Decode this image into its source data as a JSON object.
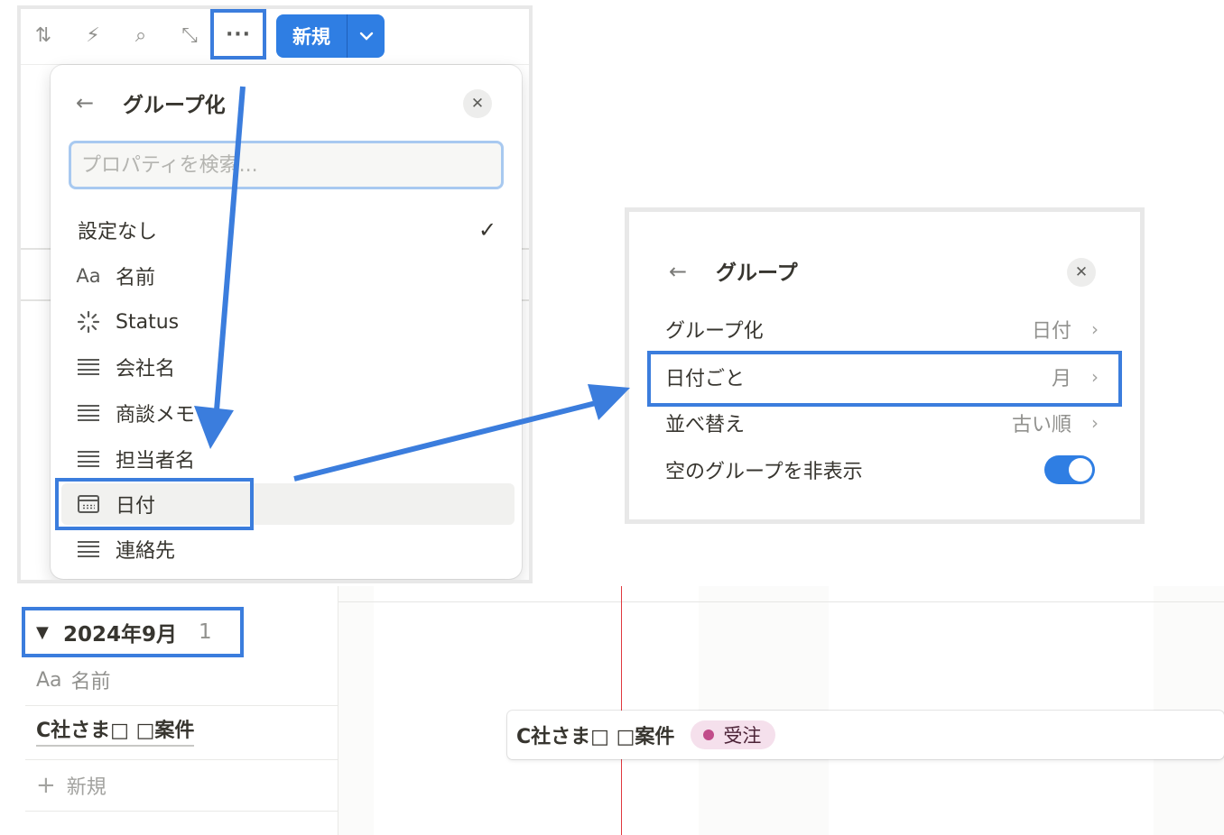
{
  "toolbar": {
    "sort_icon": "⇅",
    "automation_icon": "⚡",
    "search_icon": "⌕",
    "expand_icon": "⤡",
    "more_icon": "···",
    "new_label": "新規",
    "new_chevron": "⌄"
  },
  "group_menu": {
    "back_icon": "←",
    "title": "グループ化",
    "close_icon": "✕",
    "search_placeholder": "プロパティを検索...",
    "none_label": "設定なし",
    "check_icon": "✓",
    "items": [
      {
        "icon": "Aa",
        "label": "名前"
      },
      {
        "icon": "✳",
        "label": "Status"
      },
      {
        "icon": "lines",
        "label": "会社名"
      },
      {
        "icon": "lines",
        "label": "商談メモ"
      },
      {
        "icon": "lines",
        "label": "担当者名"
      },
      {
        "icon": "calendar",
        "label": "日付"
      },
      {
        "icon": "lines",
        "label": "連絡先"
      }
    ]
  },
  "group_panel": {
    "back_icon": "←",
    "title": "グループ",
    "close_icon": "✕",
    "rows": [
      {
        "label": "グループ化",
        "value": "日付",
        "chevron": "›"
      },
      {
        "label": "日付ごと",
        "value": "月",
        "chevron": "›"
      },
      {
        "label": "並べ替え",
        "value": "古い順",
        "chevron": "›"
      },
      {
        "label": "空のグループを非表示",
        "toggle_on": true
      }
    ]
  },
  "timeline": {
    "group_toggle": "▼",
    "group_title": "2024年9月",
    "group_count": "1",
    "name_column_icon": "Aa",
    "name_column_label": "名前",
    "row_title": "C社さま□ □案件",
    "add_icon": "+",
    "add_label": "新規",
    "card_title": "C社さま□ □案件",
    "status_label": "受注",
    "status_color": "#c14c8a"
  },
  "colors": {
    "accent": "#2f7ee3",
    "highlight": "#3b7ddd",
    "today_line": "#e0383e"
  }
}
